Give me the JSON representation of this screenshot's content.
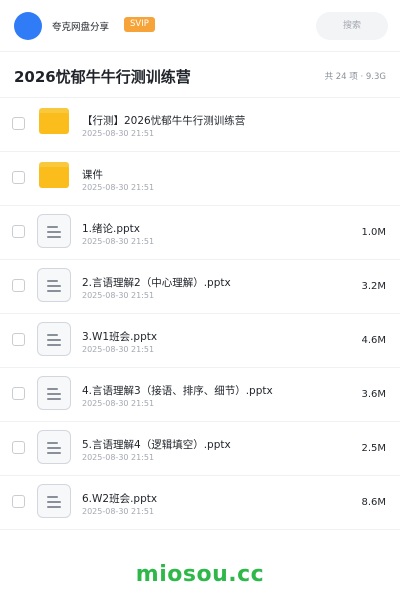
{
  "header": {
    "brand_name": "夸克网盘分享",
    "svip_badge": "SVIP",
    "search_placeholder": "搜索"
  },
  "title": {
    "text": "2026忧郁牛牛行测训练营",
    "summary": "共 24 项 · 9.3G"
  },
  "files": [
    {
      "type": "folder",
      "name": "【行测】2026忧郁牛牛行测训练营",
      "date": "2025-08-30 21:51",
      "size": ""
    },
    {
      "type": "folder",
      "name": "课件",
      "date": "2025-08-30 21:51",
      "size": ""
    },
    {
      "type": "doc",
      "name": "1.绪论.pptx",
      "date": "2025-08-30 21:51",
      "size": "1.0M"
    },
    {
      "type": "doc",
      "name": "2.言语理解2（中心理解）.pptx",
      "date": "2025-08-30 21:51",
      "size": "3.2M"
    },
    {
      "type": "doc",
      "name": "3.W1班会.pptx",
      "date": "2025-08-30 21:51",
      "size": "4.6M"
    },
    {
      "type": "doc",
      "name": "4.言语理解3（接语、排序、细节）.pptx",
      "date": "2025-08-30 21:51",
      "size": "3.6M"
    },
    {
      "type": "doc",
      "name": "5.言语理解4（逻辑填空）.pptx",
      "date": "2025-08-30 21:51",
      "size": "2.5M"
    },
    {
      "type": "doc",
      "name": "6.W2班会.pptx",
      "date": "2025-08-30 21:51",
      "size": "8.6M"
    }
  ],
  "watermark": "miosou.cc",
  "colors": {
    "accent_blue": "#2f7cf6",
    "svip_orange": "#f6a43a",
    "folder_yellow": "#fbbd1b",
    "watermark_green": "#2fb84a"
  }
}
